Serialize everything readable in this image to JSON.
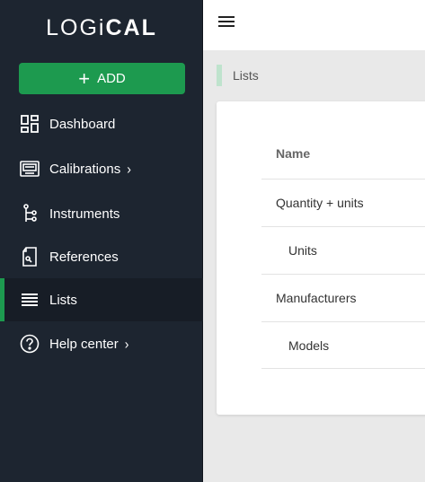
{
  "app": {
    "logo_thin": "LOGi",
    "logo_bold": "CAL"
  },
  "sidebar": {
    "add_label": "ADD",
    "items": [
      {
        "label": "Dashboard",
        "icon": "dashboard-icon"
      },
      {
        "label": "Calibrations",
        "icon": "calibrations-icon",
        "chevron": "›"
      },
      {
        "label": "Instruments",
        "icon": "instruments-icon"
      },
      {
        "label": "References",
        "icon": "references-icon"
      },
      {
        "label": "Lists",
        "icon": "list-icon",
        "active": true
      },
      {
        "label": "Help center",
        "icon": "help-icon",
        "chevron": "›"
      }
    ]
  },
  "breadcrumb": {
    "label": "Lists"
  },
  "table": {
    "header": "Name",
    "rows": [
      {
        "label": "Quantity + units"
      },
      {
        "label": "Units"
      },
      {
        "label": "Manufacturers"
      },
      {
        "label": "Models"
      }
    ]
  },
  "colors": {
    "accent": "#1d9a4f",
    "sidebar": "#1d2530"
  }
}
